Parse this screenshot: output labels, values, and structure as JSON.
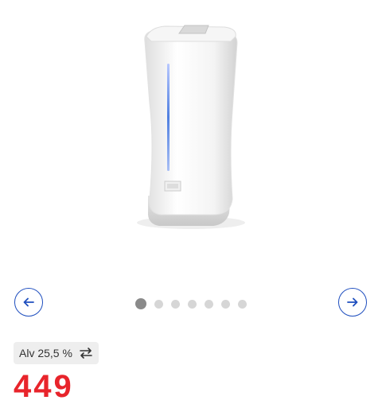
{
  "colors": {
    "accent": "#1f4fbf",
    "price": "#e8242b"
  },
  "gallery": {
    "slide_count": 7,
    "active_index": 0,
    "prev_icon": "arrow-left-icon",
    "next_icon": "arrow-right-icon"
  },
  "vat": {
    "label": "Alv 25,5 %",
    "icon": "swap-arrows-icon"
  },
  "price": {
    "value": "449"
  }
}
